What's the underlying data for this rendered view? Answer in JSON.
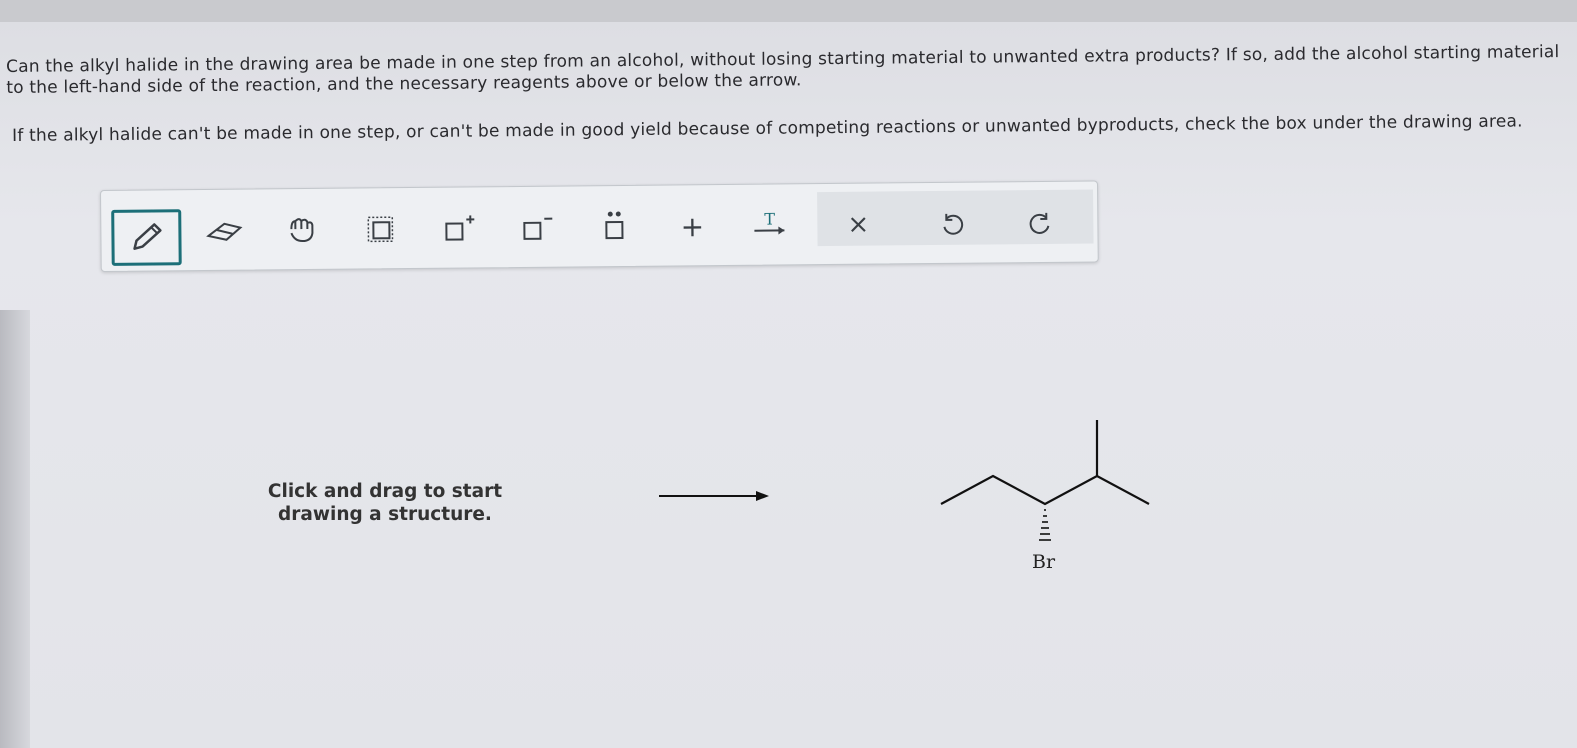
{
  "question": {
    "paragraph1": "Can the alkyl halide in the drawing area be made in one step from an alcohol, without losing starting material to unwanted extra products? If so, add the alcohol starting material to the left-hand side of the reaction, and the necessary reagents above or below the arrow.",
    "paragraph2": "If the alkyl halide can't be made in one step, or can't be made in good yield because of competing reactions or unwanted byproducts, check the box under the drawing area."
  },
  "toolbar": {
    "tools": [
      "pencil-icon",
      "eraser-icon",
      "hand-icon",
      "selection-box-icon",
      "positive-charge-icon",
      "negative-charge-icon",
      "lone-pair-icon",
      "plus-icon",
      "reaction-arrow-icon",
      "clear-icon",
      "undo-icon",
      "redo-icon"
    ],
    "plus_glyph": "+",
    "arrow_label": "T",
    "clear_glyph": "×"
  },
  "canvas": {
    "hint": "Click and drag to start drawing a structure.",
    "product_atom": "Br"
  },
  "colors": {
    "accent": "#1c6f78",
    "toolbar_bg": "#eef0f3"
  }
}
